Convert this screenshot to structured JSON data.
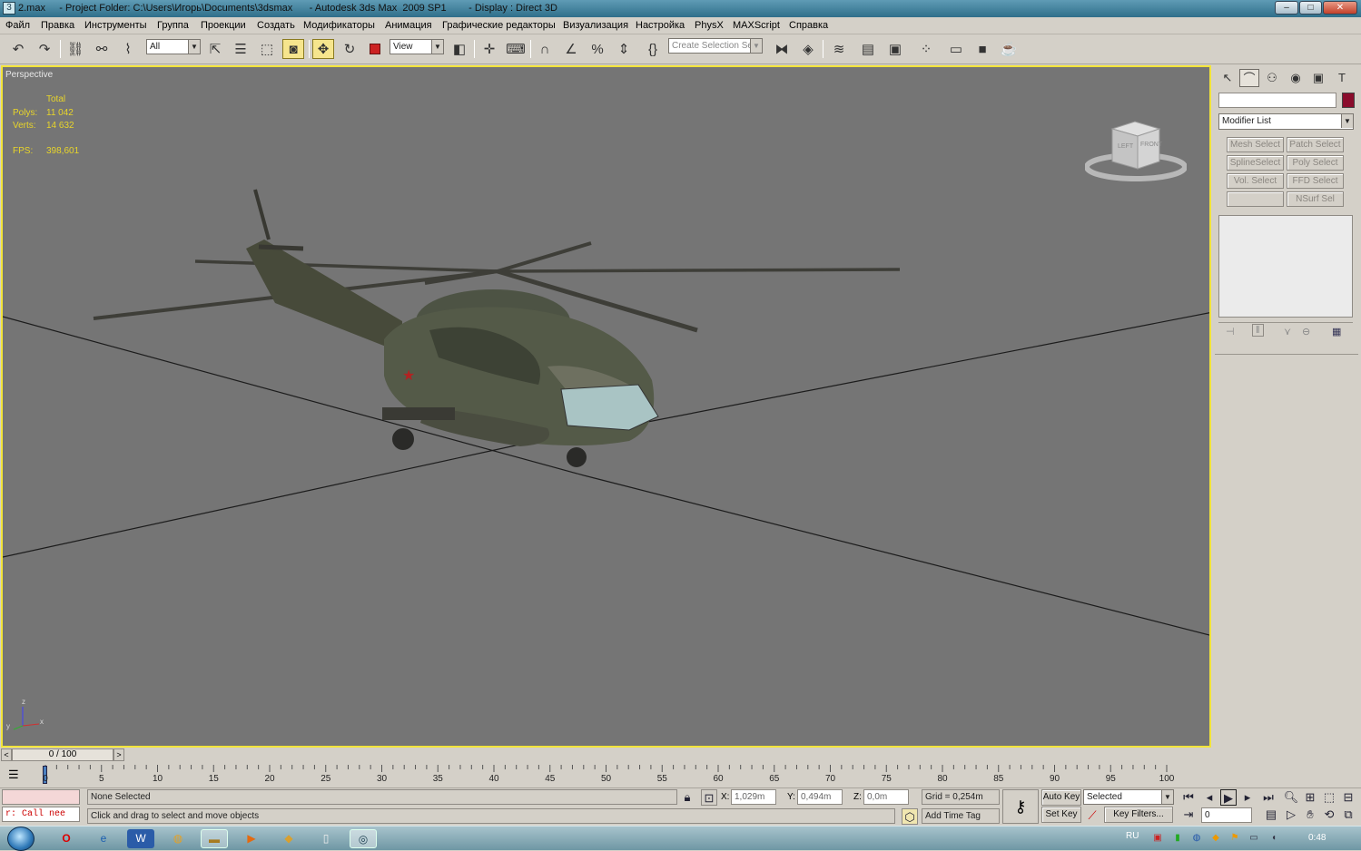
{
  "window": {
    "title": "2.max     - Project Folder: C:\\Users\\Игорь\\Documents\\3dsmax      - Autodesk 3ds Max  2009 SP1        - Display : Direct 3D",
    "app_icon": "3",
    "buttons": {
      "minimize": "–",
      "maximize": "□",
      "close": "✕"
    }
  },
  "menu": [
    "Файл",
    "Правка",
    "Инструменты",
    "Группа",
    "Проекции",
    "Создать",
    "Модификаторы",
    "Анимация",
    "Графические редакторы",
    "Визуализация",
    "Настройка",
    "PhysX",
    "MAXScript",
    "Справка"
  ],
  "toolbar": {
    "selection_filter": "All",
    "reference_coord": "View",
    "named_selection_placeholder": "Create Selection Set",
    "icons": [
      "undo-icon",
      "redo-icon",
      "select-and-link-icon",
      "unlink-icon",
      "bind-space-warp-icon",
      "select-object-icon",
      "select-by-name-icon",
      "rectangular-region-icon",
      "window-crossing-icon",
      "select-and-move-icon",
      "select-and-rotate-icon",
      "select-and-scale-icon",
      "use-pivot-center-icon",
      "select-manipulate-icon",
      "keyboard-shortcut-icon",
      "snaps-toggle-icon",
      "angle-snap-icon",
      "percent-snap-icon",
      "spinner-snap-icon",
      "edit-named-selections-icon",
      "mirror-icon",
      "align-icon",
      "layer-manager-icon",
      "curve-editor-icon",
      "schematic-view-icon",
      "material-editor-icon",
      "render-setup-icon",
      "rendered-frame-window-icon",
      "quick-render-icon"
    ]
  },
  "viewport": {
    "label": "Perspective",
    "stats": {
      "header": "Total",
      "polys_label": "Polys:",
      "polys_value": "11 042",
      "verts_label": "Verts:",
      "verts_value": "14 632",
      "fps_label": "FPS:",
      "fps_value": "398,601"
    },
    "viewcube": {
      "left": "LEFT",
      "front": "FRONT"
    },
    "axis": {
      "z": "z",
      "x": "x",
      "y": "y"
    }
  },
  "command_panel": {
    "object_name": "",
    "modifier_list": "Modifier List",
    "modifier_buttons": [
      [
        "Mesh Select",
        "Patch Select"
      ],
      [
        "SplineSelect",
        "Poly Select"
      ],
      [
        "Vol. Select",
        "FFD Select"
      ],
      [
        "",
        "NSurf Sel"
      ]
    ],
    "colors": {
      "object_color": "#8a0c2c"
    }
  },
  "timeline": {
    "frame": "0 / 100",
    "ticks": [
      "0",
      "5",
      "10",
      "15",
      "20",
      "25",
      "30",
      "35",
      "40",
      "45",
      "50",
      "55",
      "60",
      "65",
      "70",
      "75",
      "80",
      "85",
      "90",
      "95",
      "100"
    ]
  },
  "status": {
    "listener": "r: Call nee",
    "selection": "None Selected",
    "prompt": "Click and drag to select and move objects",
    "x_label": "X:",
    "x_value": "1,029m",
    "y_label": "Y:",
    "y_value": "0,494m",
    "z_label": "Z:",
    "z_value": "0,0m",
    "grid": "Grid = 0,254m",
    "add_time_tag": "Add Time Tag",
    "auto_key": "Auto Key",
    "set_key": "Set Key",
    "key_mode": "Selected",
    "key_filters": "Key Filters...",
    "current_frame": "0"
  },
  "taskbar": {
    "language": "RU",
    "clock": "0:48"
  }
}
